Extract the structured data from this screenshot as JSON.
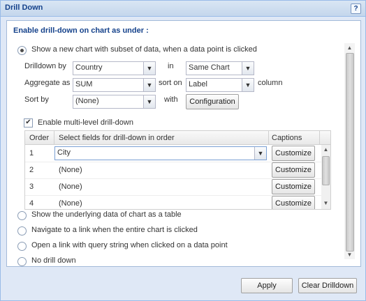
{
  "window": {
    "title": "Drill Down",
    "help_label": "?"
  },
  "heading": "Enable drill-down on chart as under :",
  "options": {
    "show_subset": "Show a new chart with subset of data, when a data point is clicked",
    "underlying_table": "Show the underlying data of chart as a table",
    "navigate_link": "Navigate to a link when the entire chart is clicked",
    "query_link": "Open a link with query string when clicked on a data point",
    "no_drill": "No drill down"
  },
  "form": {
    "drilldown_by_label": "Drilldown by",
    "drilldown_by_value": "Country",
    "in_label": "in",
    "in_value": "Same Chart",
    "aggregate_label": "Aggregate as",
    "aggregate_value": "SUM",
    "sort_on_label": "sort on",
    "sort_on_value": "Label",
    "column_label": "column",
    "sort_by_label": "Sort by",
    "sort_by_value": "(None)",
    "with_label": "with",
    "configuration_label": "Configuration"
  },
  "multilevel": {
    "label": "Enable multi-level drill-down",
    "checked": true,
    "check_glyph": "✔"
  },
  "grid": {
    "headers": {
      "order": "Order",
      "fields": "Select fields for drill-down in order",
      "captions": "Captions"
    },
    "rows": [
      {
        "order": "1",
        "field": "City",
        "action": "Customize"
      },
      {
        "order": "2",
        "field": "(None)",
        "action": "Customize"
      },
      {
        "order": "3",
        "field": "(None)",
        "action": "Customize"
      },
      {
        "order": "4",
        "field": "(None)",
        "action": "Customize"
      }
    ]
  },
  "buttons": {
    "apply": "Apply",
    "clear": "Clear Drilldown"
  },
  "icons": {
    "dropdown": "▼",
    "scroll_up": "▲",
    "scroll_down": "▼"
  },
  "colors": {
    "title_text": "#15428b",
    "frame": "#dfe8f6",
    "border": "#99bbe8"
  }
}
